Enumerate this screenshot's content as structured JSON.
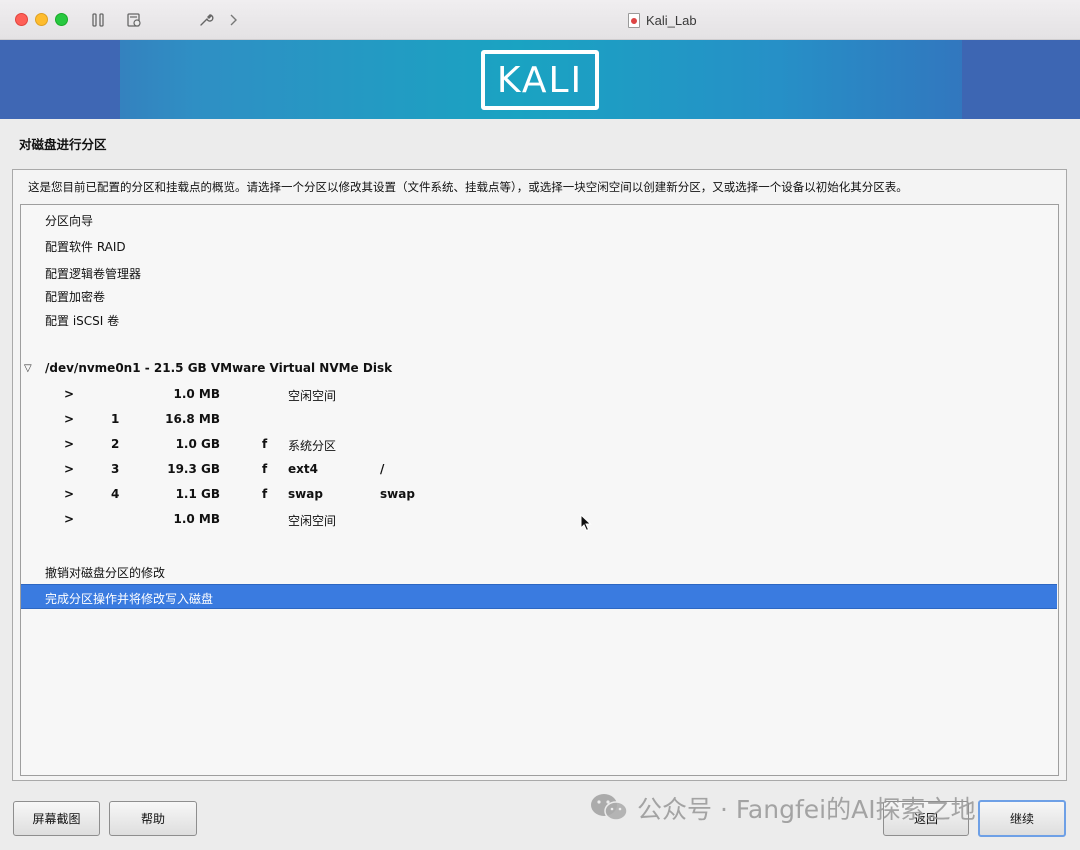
{
  "window": {
    "title": "Kali_Lab"
  },
  "banner": {
    "logo_text": "KALI"
  },
  "page": {
    "title": "对磁盘进行分区",
    "description": "这是您目前已配置的分区和挂载点的概览。请选择一个分区以修改其设置（文件系统、挂载点等），或选择一块空闲空间以创建新分区，又或选择一个设备以初始化其分区表。"
  },
  "menu": {
    "items": [
      "分区向导",
      "配置软件 RAID",
      "配置逻辑卷管理器",
      "配置加密卷",
      "配置 iSCSI 卷"
    ]
  },
  "disk": {
    "label": "/dev/nvme0n1 - 21.5 GB VMware Virtual NVMe Disk",
    "expand_glyph": "▽"
  },
  "partitions": [
    {
      "arrow": ">",
      "num": "",
      "size": "1.0 MB",
      "flag": "",
      "type": "空闲空间",
      "mount": ""
    },
    {
      "arrow": ">",
      "num": "1",
      "size": "16.8 MB",
      "flag": "",
      "type": "",
      "mount": ""
    },
    {
      "arrow": ">",
      "num": "2",
      "size": "1.0 GB",
      "flag": "f",
      "type": "系统分区",
      "mount": ""
    },
    {
      "arrow": ">",
      "num": "3",
      "size": "19.3 GB",
      "flag": "f",
      "type": "ext4",
      "mount": "/"
    },
    {
      "arrow": ">",
      "num": "4",
      "size": "1.1 GB",
      "flag": "f",
      "type": "swap",
      "mount": "swap"
    },
    {
      "arrow": ">",
      "num": "",
      "size": "1.0 MB",
      "flag": "",
      "type": "空闲空间",
      "mount": ""
    }
  ],
  "actions": {
    "undo": "撤销对磁盘分区的修改",
    "finish": "完成分区操作并将修改写入磁盘"
  },
  "buttons": {
    "screenshot": "屏幕截图",
    "help": "帮助",
    "back": "返回",
    "continue": "继续"
  },
  "watermark": {
    "text": "公众号 · Fangfei的AI探索之地"
  },
  "colors": {
    "selection": "#3a7be0",
    "banner": "#1aa3c2"
  }
}
